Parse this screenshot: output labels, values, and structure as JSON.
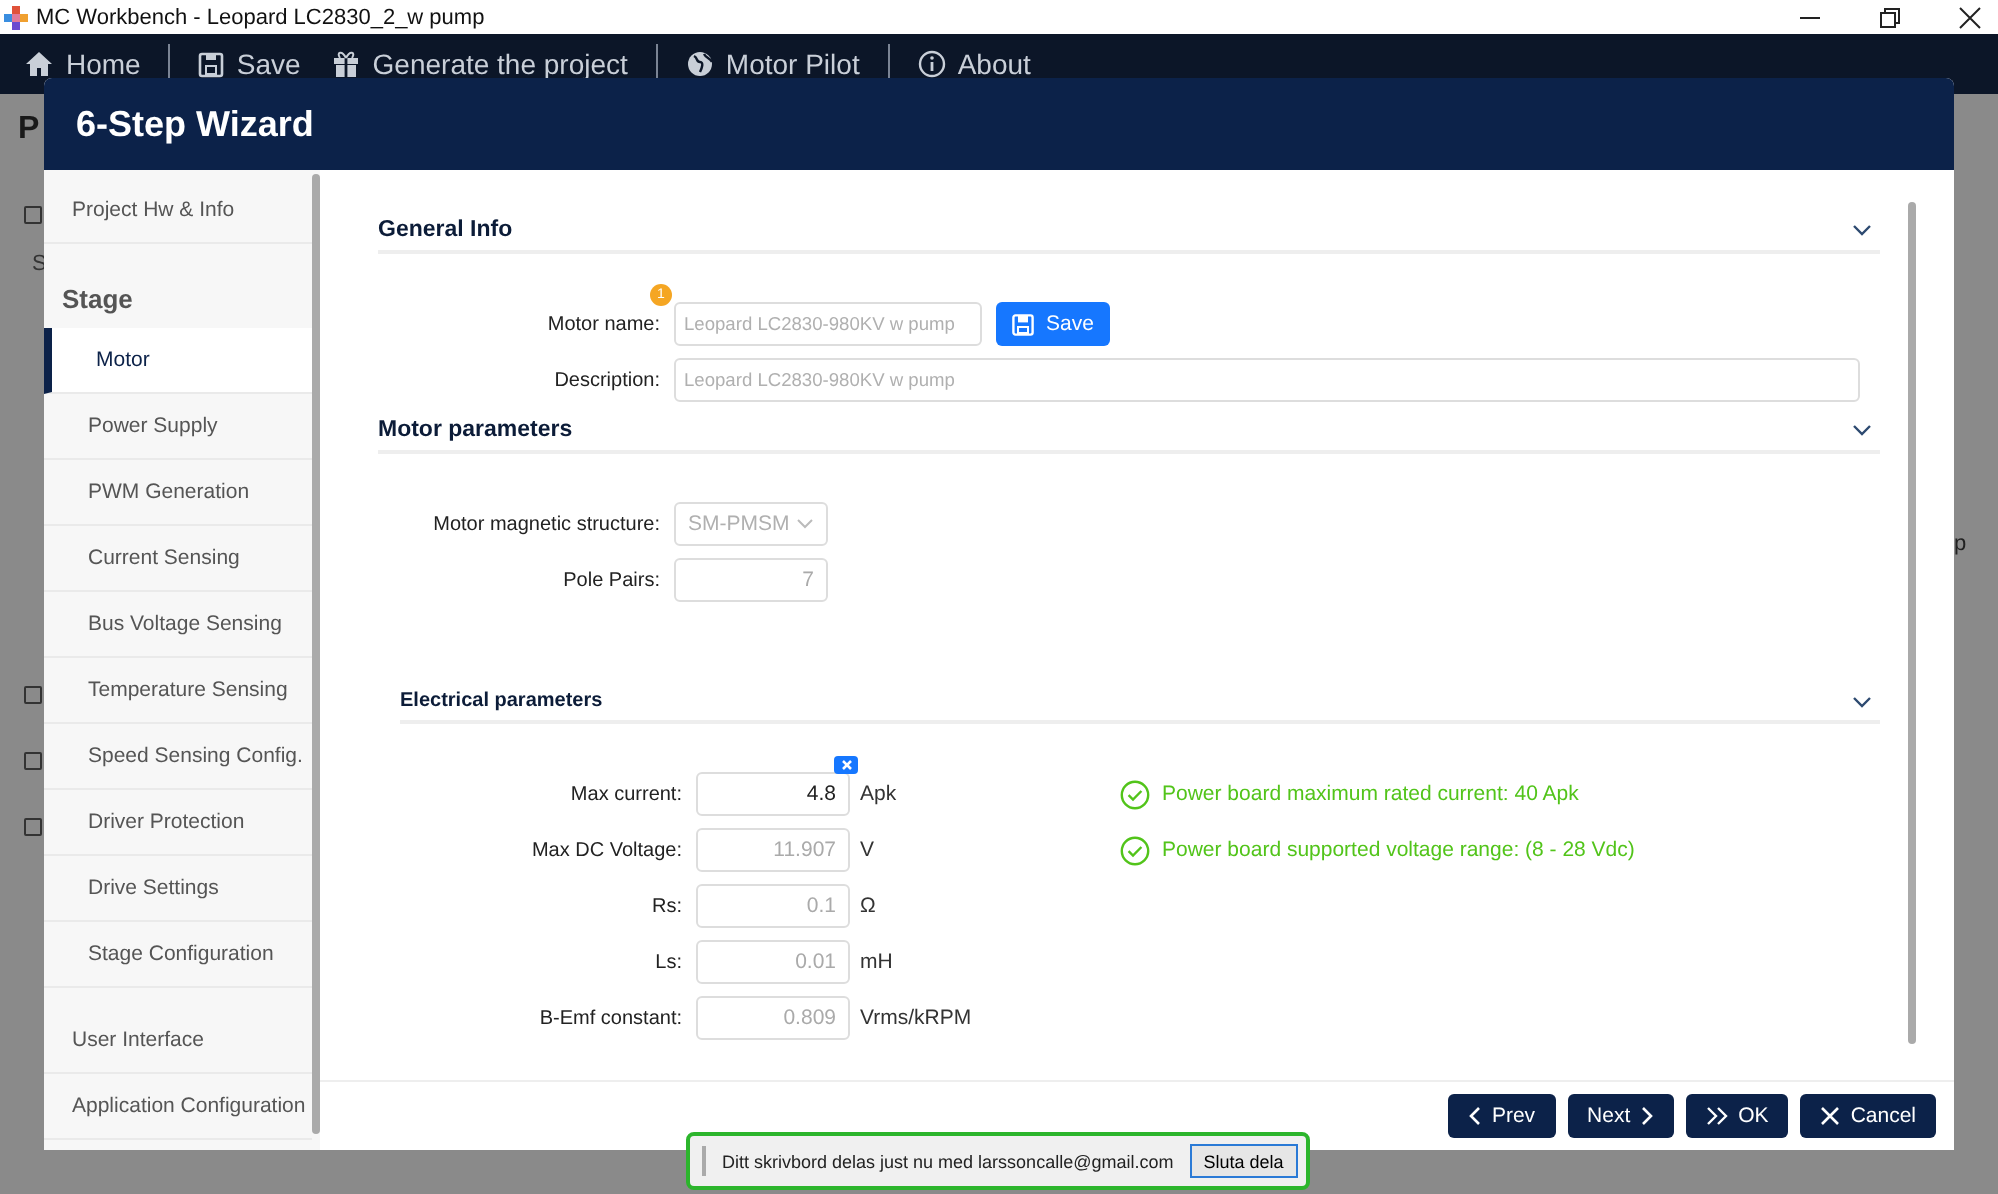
{
  "window": {
    "title": "MC Workbench - Leopard LC2830_2_w pump"
  },
  "nav": [
    {
      "label": "Home"
    },
    {
      "label": "Save"
    },
    {
      "label": "Generate the project"
    },
    {
      "label": "Motor Pilot"
    },
    {
      "label": "About"
    }
  ],
  "background": {
    "heading": "P",
    "side_letter": "S",
    "edge_letter": "p",
    "checkboxes": [
      {
        "checked": false
      },
      {
        "checked": false
      },
      {
        "checked": false
      },
      {
        "checked": false
      }
    ]
  },
  "wizard": {
    "title": "6-Step Wizard",
    "sidebar": [
      {
        "label": "Project Hw & Info",
        "kind": "top",
        "selected": false
      },
      {
        "label": "Stage",
        "kind": "heading",
        "selected": false
      },
      {
        "label": "Motor",
        "kind": "sub",
        "selected": true
      },
      {
        "label": "Power Supply",
        "kind": "sub",
        "selected": false
      },
      {
        "label": "PWM Generation",
        "kind": "sub",
        "selected": false
      },
      {
        "label": "Current Sensing",
        "kind": "sub",
        "selected": false
      },
      {
        "label": "Bus Voltage Sensing",
        "kind": "sub",
        "selected": false
      },
      {
        "label": "Temperature Sensing",
        "kind": "sub",
        "selected": false
      },
      {
        "label": "Speed Sensing Config.",
        "kind": "sub",
        "selected": false
      },
      {
        "label": "Driver Protection",
        "kind": "sub",
        "selected": false
      },
      {
        "label": "Drive Settings",
        "kind": "sub",
        "selected": false
      },
      {
        "label": "Stage Configuration",
        "kind": "sub",
        "selected": false
      },
      {
        "label": "User Interface",
        "kind": "top",
        "selected": false
      },
      {
        "label": "Application Configuration",
        "kind": "top",
        "selected": false
      }
    ],
    "sections": [
      {
        "title": "General Info",
        "kind": "section",
        "rows": [
          {
            "kind": "text",
            "label": "Motor name:",
            "placeholder": "Leopard LC2830-980KV w pump",
            "badge": "1",
            "button": "Save"
          },
          {
            "kind": "text",
            "label": "Description:",
            "placeholder": "Leopard LC2830-980KV w pump"
          }
        ]
      },
      {
        "title": "Motor parameters",
        "kind": "section",
        "rows": [
          {
            "kind": "select",
            "label": "Motor magnetic structure:",
            "value": "SM-PMSM",
            "disabled": true
          },
          {
            "kind": "number",
            "label": "Pole Pairs:",
            "value": "7",
            "disabled": true
          }
        ]
      },
      {
        "title": "Electrical parameters",
        "kind": "subsection",
        "rows": [
          {
            "kind": "number",
            "label": "Max current:",
            "value": "4.8",
            "unit": "Apk",
            "disabled": false,
            "clearable": true,
            "note": "Power board maximum rated current: 40 Apk"
          },
          {
            "kind": "number",
            "label": "Max DC Voltage:",
            "value": "11.907",
            "unit": "V",
            "disabled": true,
            "note": "Power board supported voltage range: (8 - 28 Vdc)"
          },
          {
            "kind": "number",
            "label": "Rs:",
            "value": "0.1",
            "unit": "Ω",
            "disabled": true
          },
          {
            "kind": "number",
            "label": "Ls:",
            "value": "0.01",
            "unit": "mH",
            "disabled": true
          },
          {
            "kind": "number",
            "label": "B-Emf constant:",
            "value": "0.809",
            "unit": "Vrms/kRPM",
            "disabled": true
          }
        ]
      }
    ],
    "buttons": [
      {
        "label": "Prev"
      },
      {
        "label": "Next"
      },
      {
        "label": "OK"
      },
      {
        "label": "Cancel"
      }
    ]
  },
  "share_bar": {
    "message": "Ditt skrivbord delas just nu med larssoncalle@gmail.com",
    "button": "Sluta dela"
  }
}
